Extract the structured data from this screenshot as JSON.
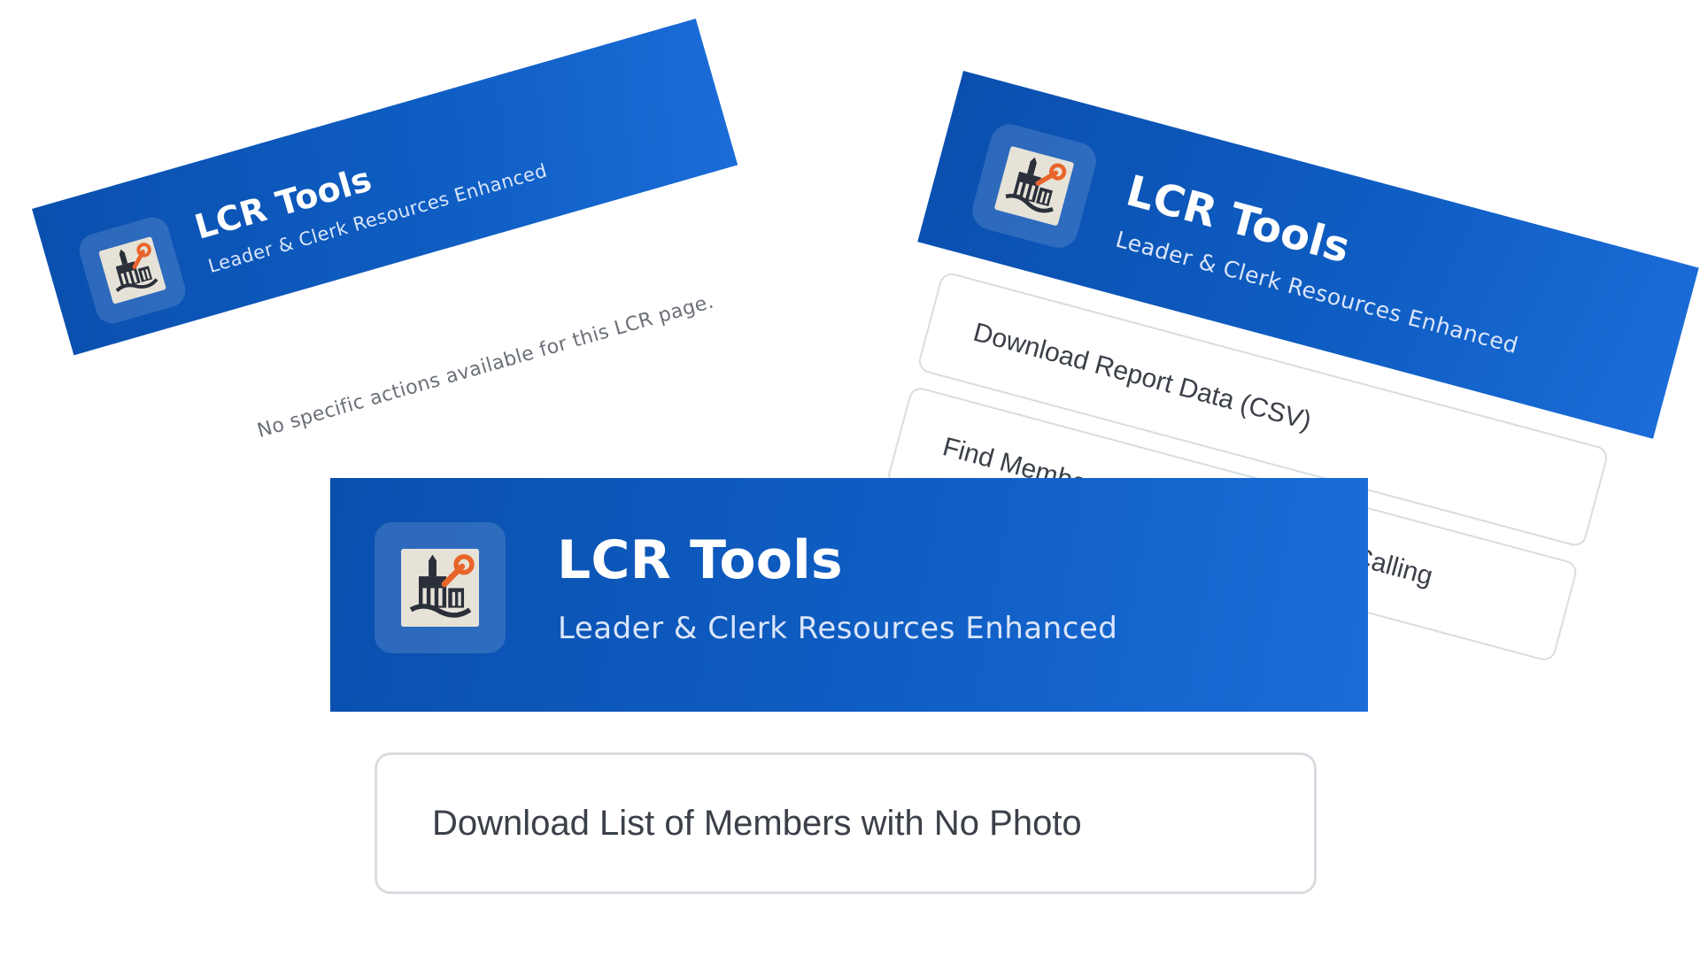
{
  "app": {
    "title": "LCR Tools",
    "subtitle": "Leader & Clerk Resources Enhanced",
    "logo_icon": "church-wrench-icon"
  },
  "panel_empty": {
    "message": "No specific actions available for this LCR page."
  },
  "panel_report": {
    "actions": [
      {
        "label": "Download Report Data (CSV)"
      },
      {
        "label": "Find Members with More Than One Calling"
      }
    ]
  },
  "panel_photo": {
    "actions": [
      {
        "label": "Download List of Members with No Photo"
      }
    ]
  },
  "colors": {
    "header_start": "#0a4fae",
    "header_end": "#1a6ad6",
    "button_border": "#d9dce1",
    "button_text": "#3b4048",
    "accent_orange": "#e8652a"
  }
}
